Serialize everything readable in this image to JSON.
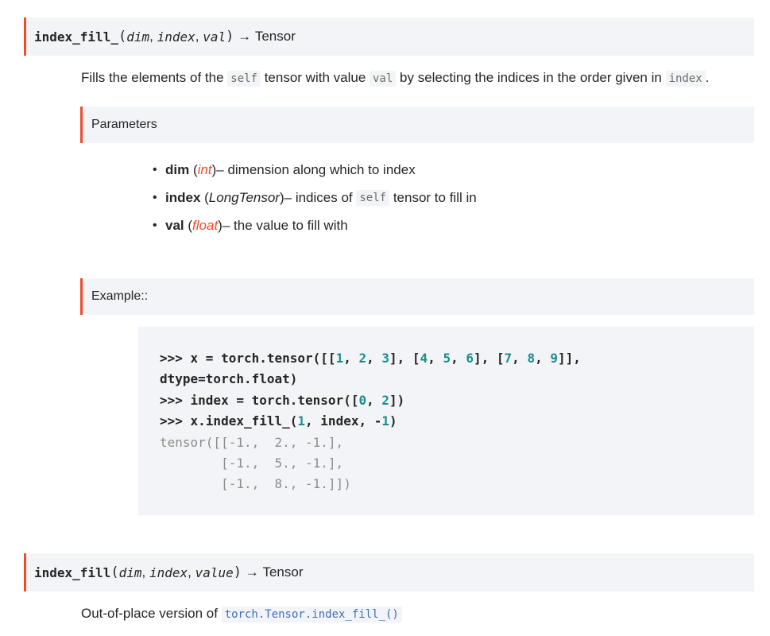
{
  "sig1": {
    "name": "index_fill_",
    "open": "(",
    "args": [
      "dim",
      "index",
      "val"
    ],
    "close": ")",
    "arrow": "→",
    "ret": "Tensor"
  },
  "desc1": {
    "pre": "Fills the elements of the ",
    "code1": "self",
    "mid1": " tensor with value ",
    "code2": "val",
    "mid2": " by selecting the indices in the order given in ",
    "code3": "index",
    "end": "."
  },
  "params_head": "Parameters",
  "params": [
    {
      "name": "dim",
      "type": "int",
      "desc": " – dimension along which to index"
    },
    {
      "name": "index",
      "type": "LongTensor",
      "desc_pre": " – indices of ",
      "code": "self",
      "desc_post": " tensor to fill in"
    },
    {
      "name": "val",
      "type": "float",
      "desc": " – the value to fill with"
    }
  ],
  "example_head": "Example::",
  "code": {
    "l1a": ">>> x = torch.tensor([[",
    "n1": "1",
    "c1": ", ",
    "n2": "2",
    "c2": ", ",
    "n3": "3",
    "l1b": "], [",
    "n4": "4",
    "c3": ", ",
    "n5": "5",
    "c4": ", ",
    "n6": "6",
    "l1c": "], [",
    "n7": "7",
    "c5": ", ",
    "n8": "8",
    "c6": ", ",
    "n9": "9",
    "l1d": "]],",
    "l2": "dtype=torch.float)",
    "l3a": ">>> index = torch.tensor([",
    "n10": "0",
    "c7": ", ",
    "n11": "2",
    "l3b": "])",
    "l4a": ">>> x.index_fill_(",
    "n12": "1",
    "l4b": ", index, -",
    "n13": "1",
    "l4c": ")",
    "o1": "tensor([[-1.,  2., -1.],",
    "o2": "        [-1.,  5., -1.],",
    "o3": "        [-1.,  8., -1.]])"
  },
  "sig2": {
    "name": "index_fill",
    "open": "(",
    "args": [
      "dim",
      "index",
      "value"
    ],
    "close": ")",
    "arrow": "→",
    "ret": "Tensor"
  },
  "desc2": {
    "pre": "Out-of-place version of ",
    "link": "torch.Tensor.index_fill_()"
  },
  "colors": {
    "accent": "#ee4c2c",
    "panel": "#f3f4f7",
    "link": "#3e6dbf",
    "number": "#1c8d8d"
  }
}
